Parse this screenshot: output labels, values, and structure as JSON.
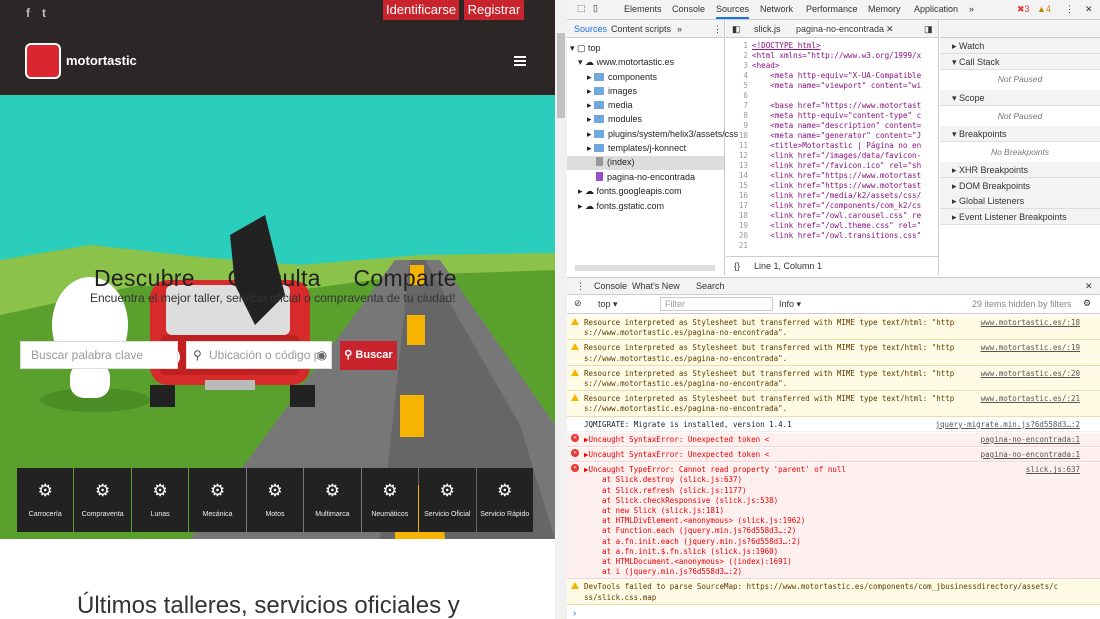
{
  "site": {
    "social": [
      "f",
      "t"
    ],
    "login": "Identificarse",
    "register": "Registrar",
    "logo": "motortastic",
    "hero_words": [
      "Descubre",
      "Consulta",
      "Comparte"
    ],
    "hero_sub": "Encuentra el mejor taller, servicio oficial o compraventa de tu ciudad!",
    "search_placeholder": "Buscar palabra clave",
    "location_placeholder": "Ubicación o código po",
    "search_button": "Buscar",
    "categories": [
      "Carrocería",
      "Compraventa",
      "Lunas",
      "Mecánica",
      "Motos",
      "Multimarca",
      "Neumáticos",
      "Servicio Oficial",
      "Servicio Rápido"
    ],
    "latest_heading": "Últimos talleres, servicios oficiales y"
  },
  "devtools": {
    "tabs": [
      "Elements",
      "Console",
      "Sources",
      "Network",
      "Performance",
      "Memory",
      "Application"
    ],
    "more": "»",
    "errors_count": "3",
    "warnings_count": "4",
    "nav_tabs": [
      "Sources",
      "Content scripts"
    ],
    "tree": {
      "top": "top",
      "domain": "www.motortastic.es",
      "folders": [
        "components",
        "images",
        "media",
        "modules",
        "plugins/system/helix3/assets/css",
        "templates/j-konnect"
      ],
      "index": "(index)",
      "page": "pagina-no-encontrada",
      "others": [
        "fonts.googleapis.com",
        "fonts.gstatic.com"
      ]
    },
    "editor_tabs": [
      "slick.js",
      "pagina-no-encontrada"
    ],
    "code_lines": [
      "<!DOCTYPE html>",
      "<html xmlns=\"http://www.w3.org/1999/x",
      "<head>",
      "    <meta http-equiv=\"X-UA-Compatible",
      "    <meta name=\"viewport\" content=\"wi",
      "",
      "    <base href=\"https://www.motortast",
      "    <meta http-equiv=\"content-type\" c",
      "    <meta name=\"description\" content=",
      "    <meta name=\"generator\" content=\"J",
      "    <title>Motortastic | Página no en",
      "    <link href=\"/images/data/favicon-",
      "    <link href=\"/favicon.ico\" rel=\"sh",
      "    <link href=\"https://www.motortast",
      "    <link href=\"https://www.motortast",
      "    <link href=\"/media/k2/assets/css/",
      "    <link href=\"/components/com_k2/cs",
      "    <link href=\"/owl.carousel.css\" re",
      "    <link href=\"/owl.theme.css\" rel=\"",
      "    <link href=\"/owl.transitions.css\"",
      ""
    ],
    "status": "Line 1, Column 1",
    "panes": [
      "Watch",
      "Call Stack",
      "Scope",
      "Breakpoints",
      "XHR Breakpoints",
      "DOM Breakpoints",
      "Global Listeners",
      "Event Listener Breakpoints"
    ],
    "not_paused": "Not Paused",
    "no_breakpoints": "No Breakpoints",
    "drawer_tabs": [
      "Console",
      "What's New",
      "Search"
    ],
    "context": "top",
    "filter_placeholder": "Filter",
    "level": "Info",
    "hidden": "29 items hidden by filters",
    "messages": [
      {
        "type": "warn",
        "text": "Resource interpreted as Stylesheet but transferred with MIME type text/html: \"http\ns://www.motortastic.es/pagina-no-encontrada\".",
        "source": "www.motortastic.es/:18"
      },
      {
        "type": "warn",
        "text": "Resource interpreted as Stylesheet but transferred with MIME type text/html: \"http\ns://www.motortastic.es/pagina-no-encontrada\".",
        "source": "www.motortastic.es/:19"
      },
      {
        "type": "warn",
        "text": "Resource interpreted as Stylesheet but transferred with MIME type text/html: \"http\ns://www.motortastic.es/pagina-no-encontrada\".",
        "source": "www.motortastic.es/:20"
      },
      {
        "type": "warn",
        "text": "Resource interpreted as Stylesheet but transferred with MIME type text/html: \"http\ns://www.motortastic.es/pagina-no-encontrada\".",
        "source": "www.motortastic.es/:21"
      },
      {
        "type": "info",
        "text": "JQMIGRATE: Migrate is installed, version 1.4.1",
        "source": "jquery-migrate.min.js?6d558d3…:2"
      },
      {
        "type": "err",
        "text": "▶Uncaught SyntaxError: Unexpected token <",
        "source": "pagina-no-encontrada:1"
      },
      {
        "type": "err",
        "text": "▶Uncaught SyntaxError: Unexpected token <",
        "source": "pagina-no-encontrada:1"
      },
      {
        "type": "err",
        "text": "▶Uncaught TypeError: Cannot read property 'parent' of null\n    at Slick.destroy (slick.js:637)\n    at Slick.refresh (slick.js:1177)\n    at Slick.checkResponsive (slick.js:538)\n    at new Slick (slick.js:181)\n    at HTMLDivElement.<anonymous> (slick.js:1962)\n    at Function.each (jquery.min.js?6d558d3…:2)\n    at a.fn.init.each (jquery.min.js?6d558d3…:2)\n    at a.fn.init.$.fn.slick (slick.js:1960)\n    at HTMLDocument.<anonymous> ((index):1691)\n    at i (jquery.min.js?6d558d3…:2)",
        "source": "slick.js:637"
      },
      {
        "type": "warn",
        "text": "DevTools failed to parse SourceMap: https://www.motortastic.es/components/com_jbusinessdirectory/assets/c\nss/slick.css.map",
        "source": ""
      }
    ],
    "prompt": "›"
  },
  "colors": {
    "brand_red": "#c9242e",
    "sky": "#2bcdbd",
    "devtools_blue": "#1a73e8"
  }
}
